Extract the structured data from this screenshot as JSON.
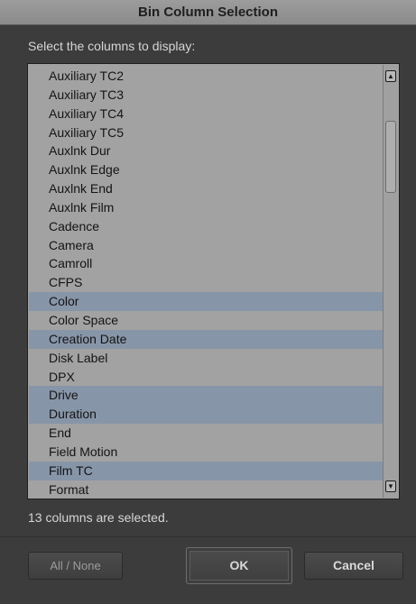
{
  "dialog": {
    "title": "Bin Column Selection",
    "instruction": "Select the columns to display:",
    "status": "13 columns are selected."
  },
  "columns": [
    {
      "label": "Auxiliary TC2",
      "selected": false
    },
    {
      "label": "Auxiliary TC3",
      "selected": false
    },
    {
      "label": "Auxiliary TC4",
      "selected": false
    },
    {
      "label": "Auxiliary TC5",
      "selected": false
    },
    {
      "label": "Auxlnk Dur",
      "selected": false
    },
    {
      "label": "Auxlnk Edge",
      "selected": false
    },
    {
      "label": "Auxlnk End",
      "selected": false
    },
    {
      "label": "Auxlnk Film",
      "selected": false
    },
    {
      "label": "Cadence",
      "selected": false
    },
    {
      "label": "Camera",
      "selected": false
    },
    {
      "label": "Camroll",
      "selected": false
    },
    {
      "label": "CFPS",
      "selected": false
    },
    {
      "label": "Color",
      "selected": true
    },
    {
      "label": "Color Space",
      "selected": false
    },
    {
      "label": "Creation Date",
      "selected": true
    },
    {
      "label": "Disk Label",
      "selected": false
    },
    {
      "label": "DPX",
      "selected": false
    },
    {
      "label": "Drive",
      "selected": true
    },
    {
      "label": "Duration",
      "selected": true
    },
    {
      "label": "End",
      "selected": false
    },
    {
      "label": "Field Motion",
      "selected": false
    },
    {
      "label": "Film TC",
      "selected": true
    },
    {
      "label": "Format",
      "selected": false
    }
  ],
  "buttons": {
    "all_none": "All / None",
    "ok": "OK",
    "cancel": "Cancel"
  },
  "colors": {
    "selected_row": "#8795a8",
    "list_background": "#a2a2a2",
    "dialog_background": "#3c3c3c"
  },
  "icons": {
    "scroll_up": "scroll-up-arrow",
    "scroll_down": "scroll-down-arrow"
  }
}
